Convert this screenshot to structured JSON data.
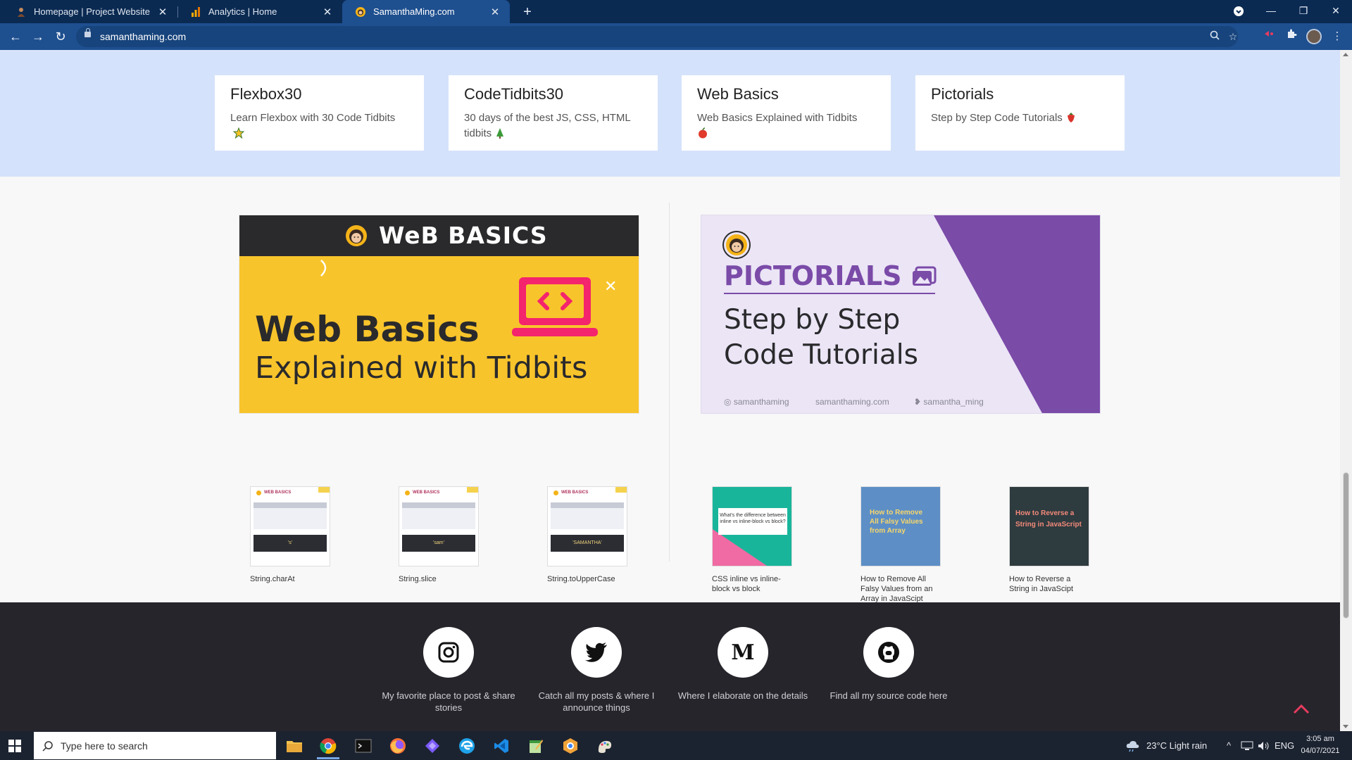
{
  "browser": {
    "tabs": [
      {
        "title": "Homepage | Project Website",
        "favicon": "person-icon"
      },
      {
        "title": "Analytics | Home",
        "favicon": "analytics-icon"
      },
      {
        "title": "SamanthaMing.com",
        "favicon": "sam-avatar-icon",
        "active": true
      }
    ],
    "url": "samanthaming.com"
  },
  "series": [
    {
      "title": "Flexbox30",
      "desc": "Learn Flexbox with 30 Code Tidbits",
      "emoji": "star-icon"
    },
    {
      "title": "CodeTidbits30",
      "desc": "30 days of the best JS, CSS, HTML tidbits",
      "emoji": "tree-icon"
    },
    {
      "title": "Web Basics",
      "desc": "Web Basics Explained with Tidbits",
      "emoji": "apple-icon"
    },
    {
      "title": "Pictorials",
      "desc": "Step by Step Code Tutorials",
      "emoji": "strawberry-icon"
    }
  ],
  "web_basics": {
    "banner_title": "WeB BASICS",
    "headline": "Web Basics",
    "subline": "Explained with Tidbits",
    "thumbs": [
      {
        "label": "String.charAt",
        "output": "'s'",
        "mini_title": "WEB BASICS"
      },
      {
        "label": "String.slice",
        "output": "'sam'",
        "mini_title": "WEB BASICS"
      },
      {
        "label": "String.toUpperCase",
        "output": "'SAMANTHA'",
        "mini_title": "WEB BASICS"
      }
    ]
  },
  "pictorials": {
    "title": "PICTORIALS",
    "sub_line1": "Step by Step",
    "sub_line2": "Code Tutorials",
    "footer": [
      "samanthaming",
      "samanthaming.com",
      "samantha_ming"
    ],
    "thumbs": [
      {
        "label": "CSS inline vs inline-block vs block",
        "text": "What's the difference between inline vs inline-block vs block?"
      },
      {
        "label": "How to Remove All Falsy Values from an Array in JavaScipt",
        "text": "How to Remove All Falsy Values from Array"
      },
      {
        "label": "How to Reverse a String in JavaScipt",
        "text": "How to Reverse a String in JavaScript"
      }
    ]
  },
  "footer": {
    "socials": [
      {
        "icon": "instagram-icon",
        "caption": "My favorite place to post & share stories"
      },
      {
        "icon": "twitter-icon",
        "caption": "Catch all my posts & where I announce things"
      },
      {
        "icon": "medium-icon",
        "caption": "Where I elaborate on the details"
      },
      {
        "icon": "github-icon",
        "caption": "Find all my source code here"
      }
    ]
  },
  "taskbar": {
    "search_placeholder": "Type here to search",
    "weather": "23°C  Light rain",
    "language": "ENG",
    "time": "3:05 am",
    "date": "04/07/2021"
  },
  "colors": {
    "accent": "#1e4f8f",
    "series_band": "#d5e2fb",
    "wb_yellow": "#f8c42b",
    "wb_pink": "#f4246d",
    "pictorials_purple": "#7b4ba8",
    "footer_bg": "#26252b",
    "to_top": "#e63b5f"
  }
}
